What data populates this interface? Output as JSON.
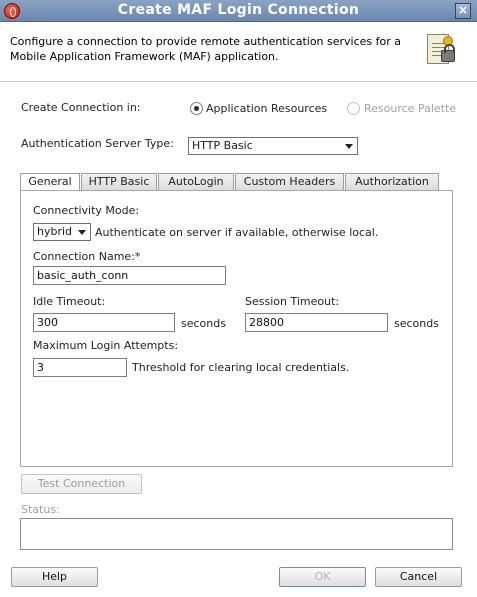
{
  "window": {
    "title": "Create MAF Login Connection"
  },
  "header": {
    "description": "Configure a connection to provide remote authentication services for a Mobile Application Framework (MAF) application."
  },
  "create_in": {
    "label": "Create Connection in:",
    "options": [
      {
        "label": "Application Resources",
        "selected": true,
        "enabled": true
      },
      {
        "label": "Resource Palette",
        "selected": false,
        "enabled": false
      }
    ]
  },
  "auth_server": {
    "label": "Authentication Server Type:",
    "value": "HTTP Basic"
  },
  "tabs": [
    "General",
    "HTTP Basic",
    "AutoLogin",
    "Custom Headers",
    "Authorization"
  ],
  "general": {
    "connectivity_mode_label": "Connectivity Mode:",
    "connectivity_mode_value": "hybrid",
    "connectivity_mode_hint": "Authenticate on server if available, otherwise local.",
    "connection_name_label": "Connection Name:*",
    "connection_name_value": "basic_auth_conn",
    "idle_timeout_label": "Idle Timeout:",
    "idle_timeout_value": "300",
    "idle_timeout_unit": "seconds",
    "session_timeout_label": "Session Timeout:",
    "session_timeout_value": "28800",
    "session_timeout_unit": "seconds",
    "max_attempts_label": "Maximum Login Attempts:",
    "max_attempts_value": "3",
    "max_attempts_hint": "Threshold for clearing local credentials."
  },
  "test_connection_label": "Test Connection",
  "status_label": "Status:",
  "footer": {
    "help_label": "Help",
    "ok_label": "OK",
    "cancel_label": "Cancel"
  },
  "colors": {
    "titlebar": "#7a94b8",
    "accent": "#6f8db9"
  }
}
